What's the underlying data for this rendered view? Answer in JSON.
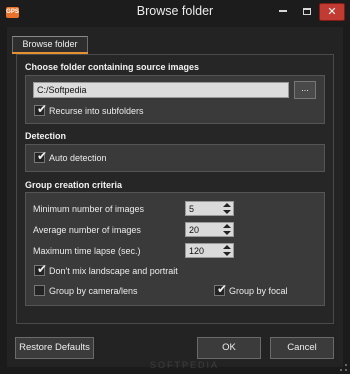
{
  "window": {
    "title": "Browse folder",
    "app_icon_text": "GPS"
  },
  "tab": {
    "label": "Browse folder"
  },
  "source": {
    "section_title": "Choose folder containing source images",
    "path_value": "C:/Softpedia",
    "browse_label": "...",
    "recurse_label": "Recurse into subfolders",
    "recurse_checked": true
  },
  "detection": {
    "section_title": "Detection",
    "auto_label": "Auto detection",
    "auto_checked": true
  },
  "criteria": {
    "section_title": "Group creation criteria",
    "min_images_label": "Minimum number of images",
    "min_images_value": "5",
    "avg_images_label": "Average number of images",
    "avg_images_value": "20",
    "max_lapse_label": "Maximum time lapse (sec.)",
    "max_lapse_value": "120",
    "no_mix_label": "Don't mix landscape and portrait",
    "no_mix_checked": true,
    "by_camera_label": "Group by camera/lens",
    "by_camera_checked": false,
    "by_focal_label": "Group by focal",
    "by_focal_checked": true
  },
  "buttons": {
    "restore": "Restore Defaults",
    "ok": "OK",
    "cancel": "Cancel"
  },
  "watermark": "SOFTPEDIA",
  "colors": {
    "close_button": "#c13b32",
    "tab_accent": "#e59233",
    "app_icon": "#e8722a"
  }
}
